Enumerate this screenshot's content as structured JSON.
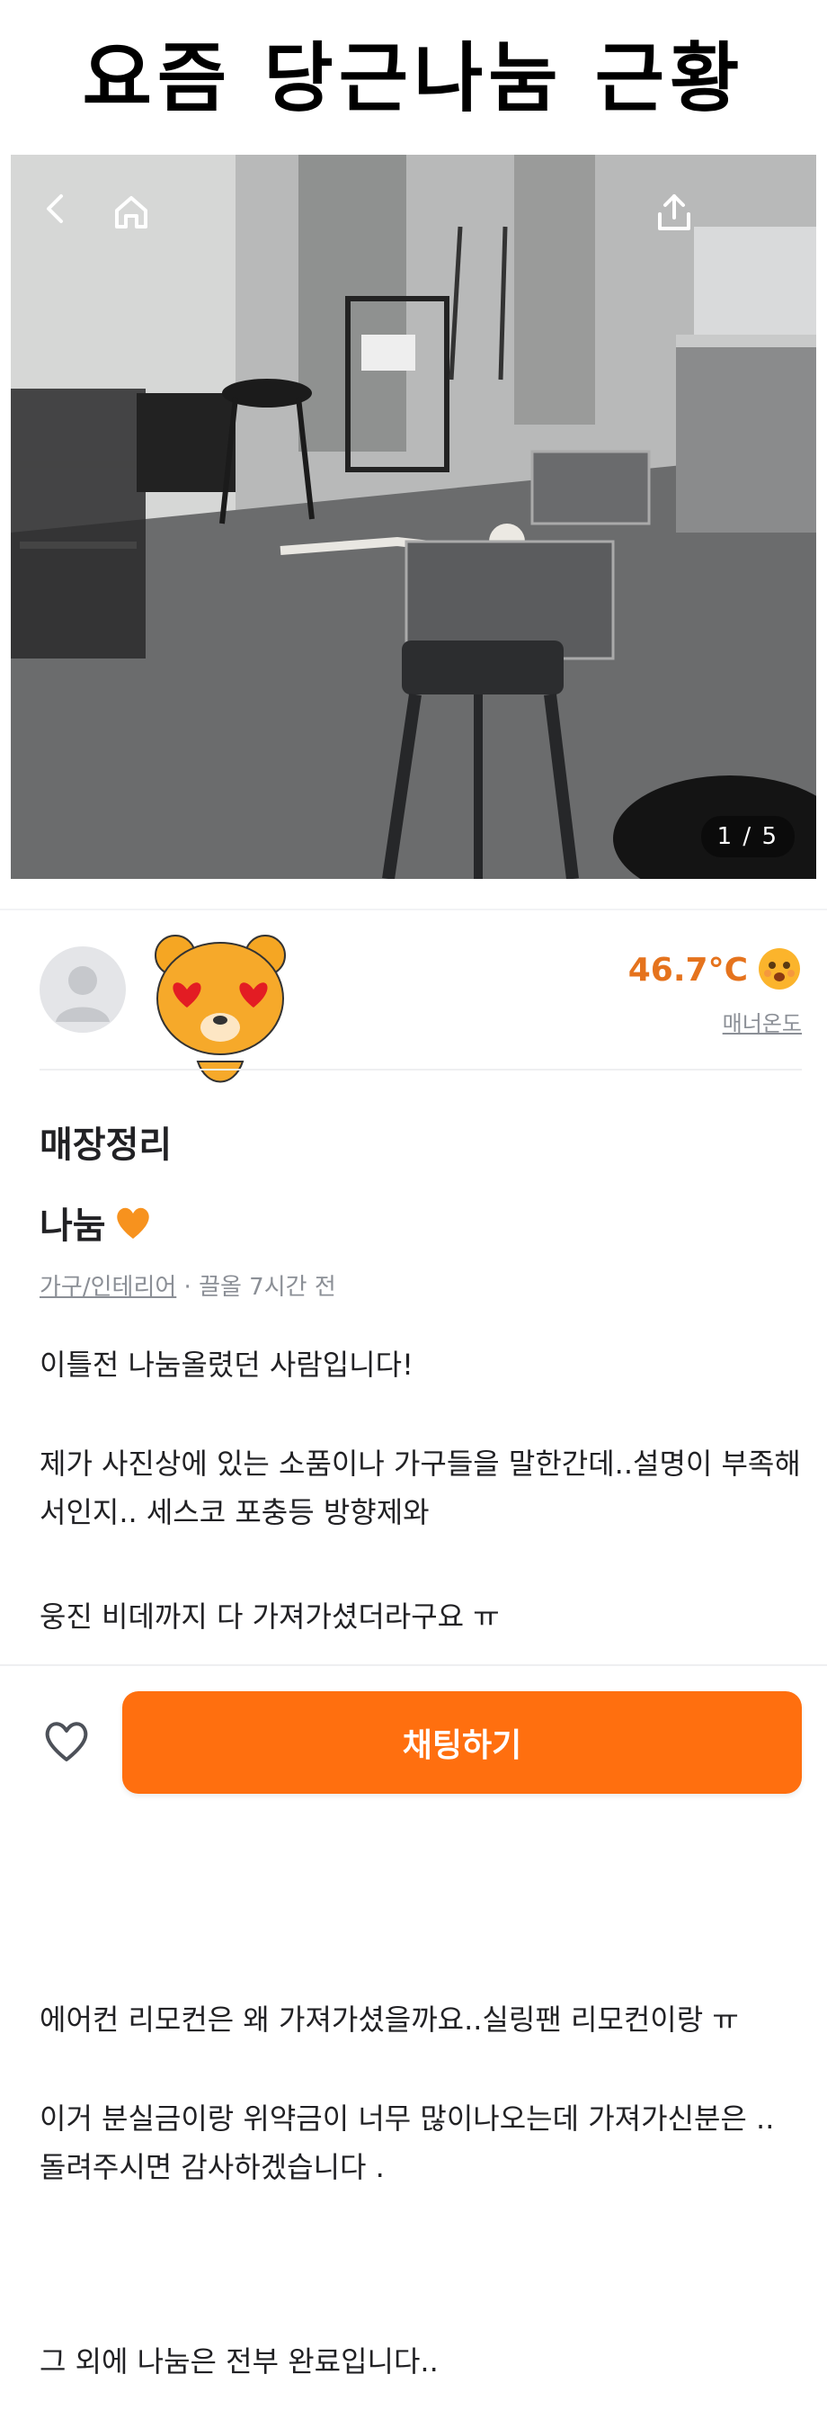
{
  "headline": "요즘 당근나눔 근황",
  "photo": {
    "alt_objects": "store interior",
    "pager": "1 / 5",
    "icons": [
      "back-icon",
      "home-icon",
      "share-icon"
    ]
  },
  "seller": {
    "temperature": "46.7°C",
    "manner_label": "매너온도"
  },
  "post": {
    "title": "매장정리",
    "subtitle": "나눔",
    "category": "가구/인테리어",
    "meta_rest": " · 끌올 7시간 전",
    "paragraphs": [
      "이틀전 나눔올렸던 사람입니다!",
      "제가 사진상에 있는 소품이나 가구들을 말한간데..설명이 부족해서인지.. 세스코 포충등 방향제와",
      "웅진 비데까지 다 가져가셨더라구요 ㅠ",
      "에어컨 리모컨은 왜 가져가셨을까요..실링팬 리모컨이랑 ㅠ",
      "이거 분실금이랑 위약금이 너무 많이나오는데 가져가신분은 .. 돌려주시면 감사하겠습니다 .",
      "그 외에 나눔은 전부 완료입니다.."
    ]
  },
  "actions": {
    "chat_label": "채팅하기"
  },
  "colors": {
    "brand": "#ff6f0f",
    "temperature": "#e5731d"
  }
}
